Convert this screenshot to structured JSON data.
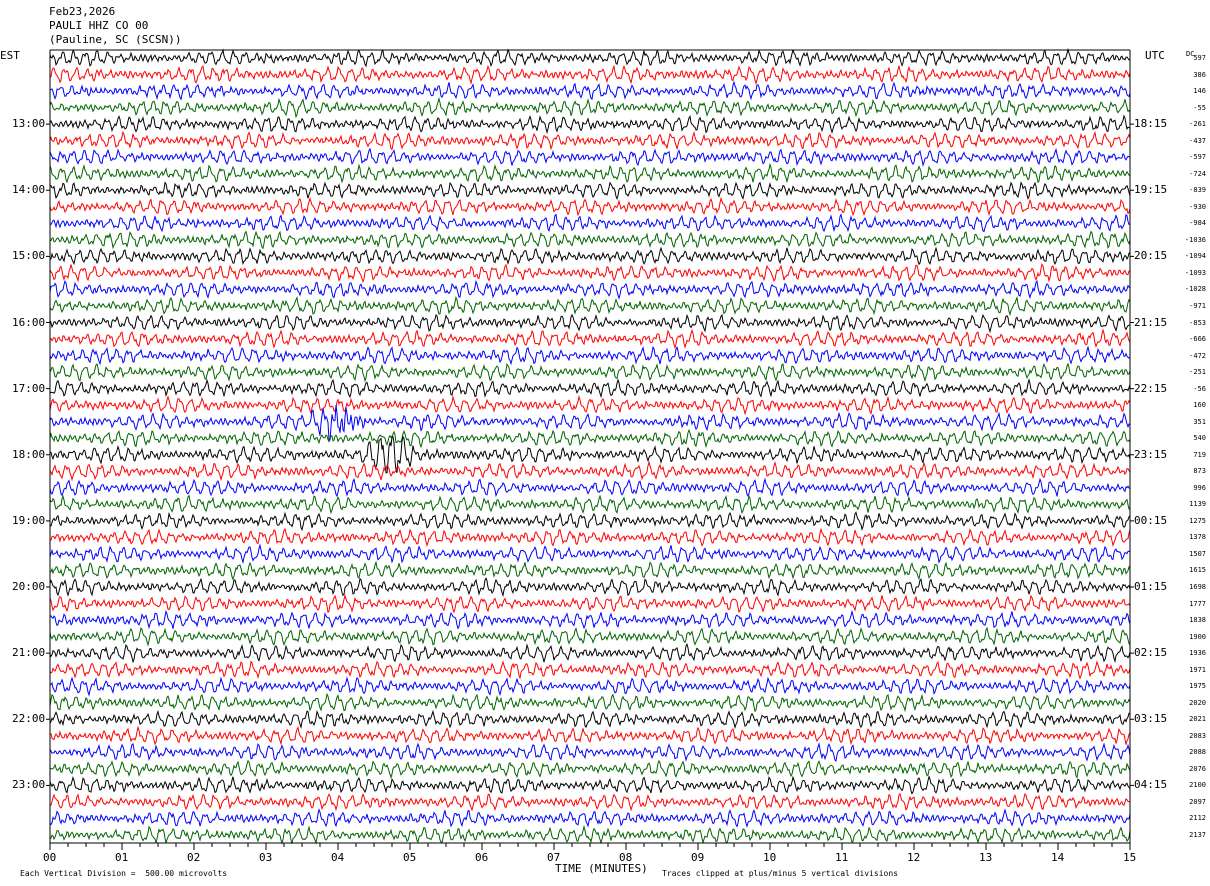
{
  "header": {
    "date": "Feb23,2026",
    "station": "PAULI HHZ CO 00",
    "location": "(Pauline, SC (SCSN))"
  },
  "labels": {
    "left_zone": "EST",
    "right_zone": "UTC",
    "dc_header": "DC",
    "xlabel": "TIME (MINUTES)",
    "scale_note": "Each Vertical Division =  500.00 microvolts",
    "clip_note": "Traces clipped at plus/minus 5 vertical divisions"
  },
  "chart_data": {
    "type": "line",
    "xlabel": "TIME (MINUTES)",
    "xlim": [
      0,
      15
    ],
    "x_ticks": [
      "00",
      "01",
      "02",
      "03",
      "04",
      "05",
      "06",
      "07",
      "08",
      "09",
      "10",
      "11",
      "12",
      "13",
      "14",
      "15"
    ],
    "trace_count": 48,
    "trace_interval_minutes": 15,
    "trace_colors": [
      "#000000",
      "#ff0000",
      "#0000ff",
      "#006400"
    ],
    "est_hour_labels": [
      "13:00",
      "14:00",
      "15:00",
      "16:00",
      "17:00",
      "18:00",
      "19:00",
      "20:00",
      "21:00",
      "22:00",
      "23:00"
    ],
    "utc_hour_labels": [
      "18:15",
      "19:15",
      "20:15",
      "21:15",
      "22:15",
      "23:15",
      "00:15",
      "01:15",
      "02:15",
      "03:15",
      "04:15"
    ],
    "dc_offsets": [
      "597",
      "386",
      "146",
      "-55",
      "-261",
      "-437",
      "-597",
      "-724",
      "-839",
      "-930",
      "-984",
      "-1036",
      "-1094",
      "-1093",
      "-1028",
      "-971",
      "-853",
      "-666",
      "-472",
      "-251",
      "-56",
      "160",
      "351",
      "540",
      "719",
      "873",
      "996",
      "1139",
      "1275",
      "1378",
      "1507",
      "1615",
      "1698",
      "1777",
      "1838",
      "1900",
      "1936",
      "1971",
      "1975",
      "2020",
      "2021",
      "2083",
      "2088",
      "2076",
      "2100",
      "2097",
      "2112",
      "2137"
    ],
    "events": [
      {
        "trace": 22,
        "minute": 4.0,
        "description": "local event"
      },
      {
        "trace": 24,
        "minute": 4.7,
        "description": "secondary arrival"
      }
    ]
  }
}
